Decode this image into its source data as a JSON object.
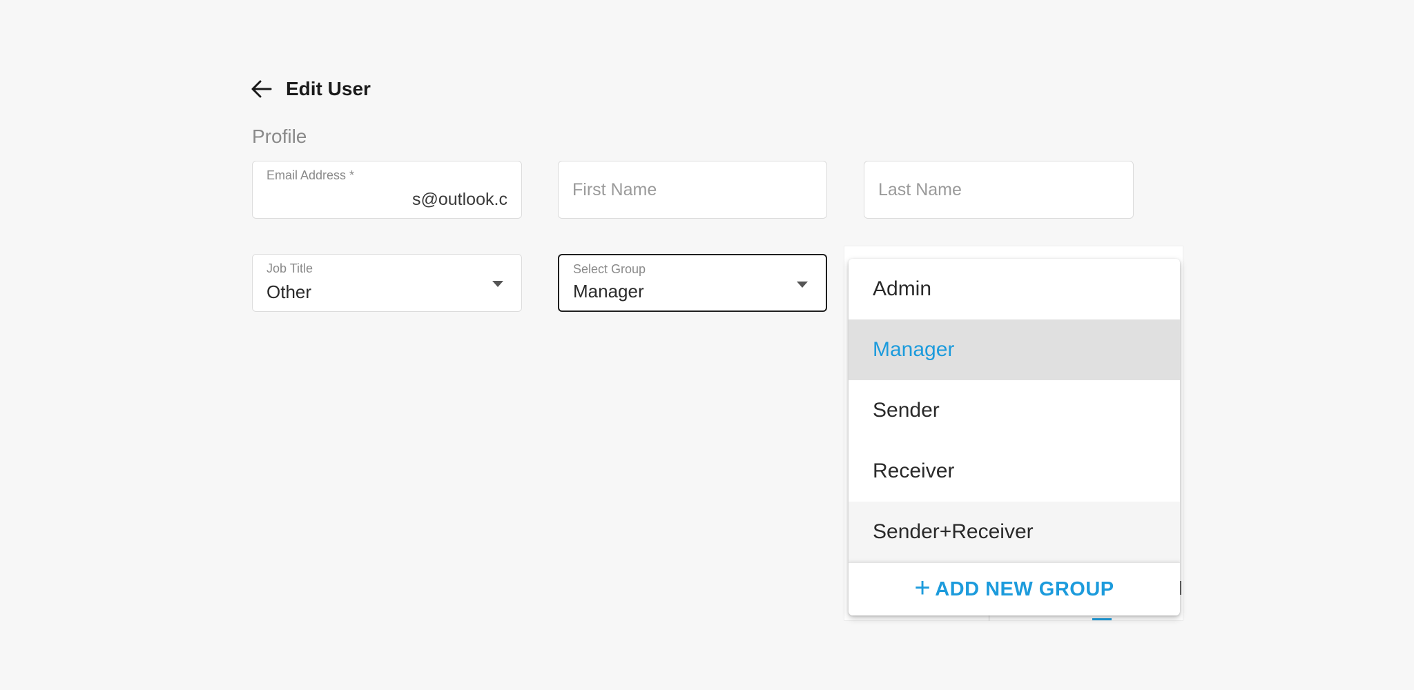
{
  "header": {
    "title": "Edit User",
    "back_icon": "arrow-left-icon"
  },
  "profile": {
    "section_title": "Profile",
    "email": {
      "label": "Email Address *",
      "value": "s@outlook.c"
    },
    "first_name": {
      "placeholder": "First Name",
      "value": ""
    },
    "last_name": {
      "placeholder": "Last Name",
      "value": ""
    },
    "job_title": {
      "label": "Job Title",
      "value": "Other"
    },
    "group": {
      "label": "Select Group",
      "value": "Manager"
    }
  },
  "group_dropdown": {
    "options": [
      {
        "label": "Admin",
        "state": "default"
      },
      {
        "label": "Manager",
        "state": "selected"
      },
      {
        "label": "Sender",
        "state": "default"
      },
      {
        "label": "Receiver",
        "state": "default"
      },
      {
        "label": "Sender+Receiver",
        "state": "hover"
      }
    ],
    "add_new": {
      "icon": "plus-icon",
      "label": "ADD NEW GROUP"
    }
  },
  "colors": {
    "accent": "#1c9bdc",
    "background": "#f7f7f7",
    "selected_bg": "#e0e0e0"
  }
}
